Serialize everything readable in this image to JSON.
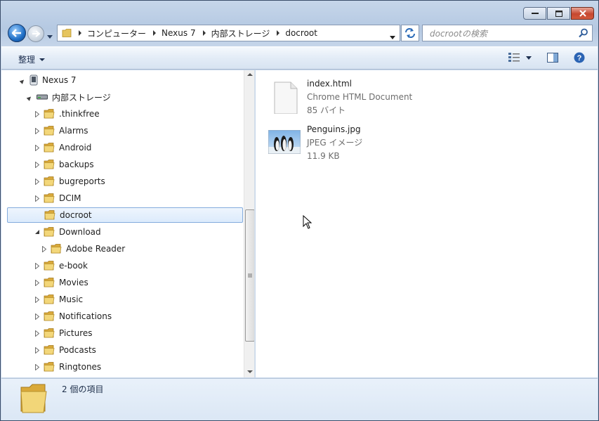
{
  "window": {
    "controls": [
      "minimize",
      "maximize",
      "close"
    ]
  },
  "nav": {
    "breadcrumbs": [
      "コンピューター",
      "Nexus 7",
      "内部ストレージ",
      "docroot"
    ],
    "search_placeholder": "docrootの検索"
  },
  "toolbar": {
    "organize_label": "整理"
  },
  "tree": {
    "root_label": "Nexus 7",
    "storage_label": "内部ストレージ",
    "items": [
      {
        "label": ".thinkfree",
        "state": "collapsed"
      },
      {
        "label": "Alarms",
        "state": "collapsed"
      },
      {
        "label": "Android",
        "state": "collapsed"
      },
      {
        "label": "backups",
        "state": "collapsed"
      },
      {
        "label": "bugreports",
        "state": "collapsed"
      },
      {
        "label": "DCIM",
        "state": "collapsed"
      },
      {
        "label": "docroot",
        "state": "selected"
      },
      {
        "label": "Download",
        "state": "expanded"
      },
      {
        "label": "Adobe Reader",
        "state": "collapsed",
        "indent": 1
      },
      {
        "label": "e-book",
        "state": "collapsed"
      },
      {
        "label": "Movies",
        "state": "collapsed"
      },
      {
        "label": "Music",
        "state": "collapsed"
      },
      {
        "label": "Notifications",
        "state": "collapsed"
      },
      {
        "label": "Pictures",
        "state": "collapsed"
      },
      {
        "label": "Podcasts",
        "state": "collapsed"
      },
      {
        "label": "Ringtones",
        "state": "collapsed"
      }
    ]
  },
  "files": [
    {
      "name": "index.html",
      "type": "Chrome HTML Document",
      "size": "85 バイト",
      "icon": "document-icon"
    },
    {
      "name": "Penguins.jpg",
      "type": "JPEG イメージ",
      "size": "11.9 KB",
      "icon": "image-thumbnail"
    }
  ],
  "status": {
    "item_count": "2 個の項目"
  },
  "colors": {
    "frame": "#c6d6ea",
    "selection_border": "#84acdd",
    "folder": "#e8c35a"
  }
}
